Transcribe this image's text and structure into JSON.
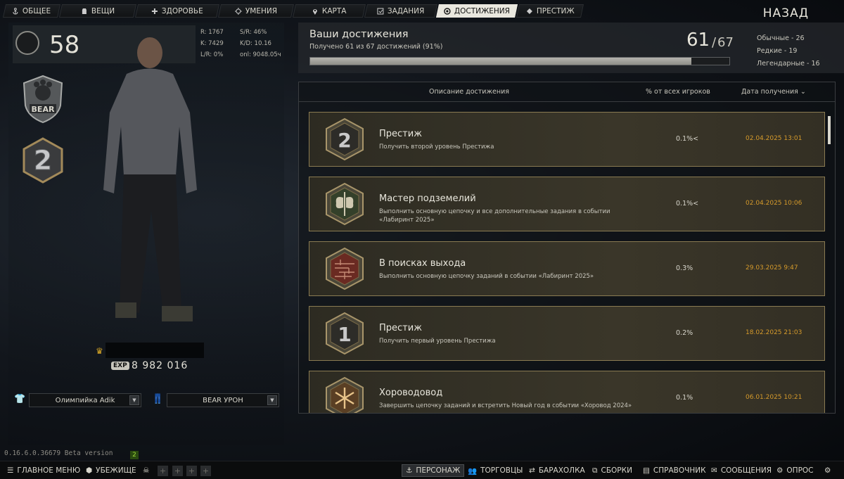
{
  "nav": {
    "tabs": [
      {
        "label": "ОБЩЕЕ",
        "icon": "anchor-icon"
      },
      {
        "label": "ВЕЩИ",
        "icon": "vest-icon"
      },
      {
        "label": "ЗДОРОВЬЕ",
        "icon": "health-icon"
      },
      {
        "label": "УМЕНИЯ",
        "icon": "skills-icon"
      },
      {
        "label": "КАРТА",
        "icon": "map-pin-icon"
      },
      {
        "label": "ЗАДАНИЯ",
        "icon": "tasks-icon"
      },
      {
        "label": "ДОСТИЖЕНИЯ",
        "icon": "achievement-icon",
        "active": true
      },
      {
        "label": "ПРЕСТИЖ",
        "icon": "prestige-icon"
      }
    ],
    "back_label": "НАЗАД"
  },
  "profile": {
    "level": "58",
    "stats": {
      "r": "R: 1767",
      "sr": "S/R: 46%",
      "k": "K: 7429",
      "kd": "K/D: 10.16",
      "lr": "L/R: 0%",
      "onl": "onl: 9048.05ч"
    },
    "faction": "BEAR",
    "prestige_level": "2",
    "exp_label": "EXP",
    "exp_value": "8 982 016",
    "outfit_top": "Олимпийка Adik",
    "outfit_bottom": "BEAR УРОН",
    "version": "0.16.6.0.36679 Beta version",
    "version_badge": "2"
  },
  "summary": {
    "title": "Ваши достижения",
    "subtitle": "Получено 61 из 67 достижений (91%)",
    "count": "61",
    "sep": "/",
    "total": "67",
    "progress": 0.91,
    "rarity": [
      "Обычные - 26",
      "Редкие - 19",
      "Легендарные - 16"
    ]
  },
  "table": {
    "headers": {
      "desc": "Описание достижения",
      "pct": "% от всех игроков",
      "date": "Дата получения ⌄"
    },
    "rows": [
      {
        "name": "Престиж",
        "desc": "Получить второй уровень Престижа",
        "pct": "0.1%<",
        "date": "02.04.2025 13:01",
        "icon": "prestige-2-icon"
      },
      {
        "name": "Мастер подземелий",
        "desc": "Выполнить основную цепочку и все дополнительные задания в событии «Лабиринт 2025»",
        "pct": "0.1%<",
        "date": "02.04.2025 10:06",
        "icon": "double-axe-icon"
      },
      {
        "name": "В поисках выхода",
        "desc": "Выполнить основную цепочку заданий в событии «Лабиринт 2025»",
        "pct": "0.3%",
        "date": "29.03.2025 9:47",
        "icon": "maze-icon"
      },
      {
        "name": "Престиж",
        "desc": "Получить первый уровень Престижа",
        "pct": "0.2%",
        "date": "18.02.2025 21:03",
        "icon": "prestige-1-icon"
      },
      {
        "name": "Хороводовод",
        "desc": "Завершить цепочку заданий и встретить Новый год в событии «Хоровод 2024»",
        "pct": "0.1%",
        "date": "06.01.2025 10:21",
        "icon": "snowflake-icon"
      }
    ]
  },
  "bottom": {
    "main_menu": "ГЛАВНОЕ МЕНЮ",
    "hideout": "УБЕЖИЩЕ",
    "character": "ПЕРСОНАЖ",
    "traders": "ТОРГОВЦЫ",
    "flea": "БАРАХОЛКА",
    "builds": "СБОРКИ",
    "handbook": "СПРАВОЧНИК",
    "messages": "СООБЩЕНИЯ",
    "survey": "ОПРОС",
    "plus": "+"
  }
}
